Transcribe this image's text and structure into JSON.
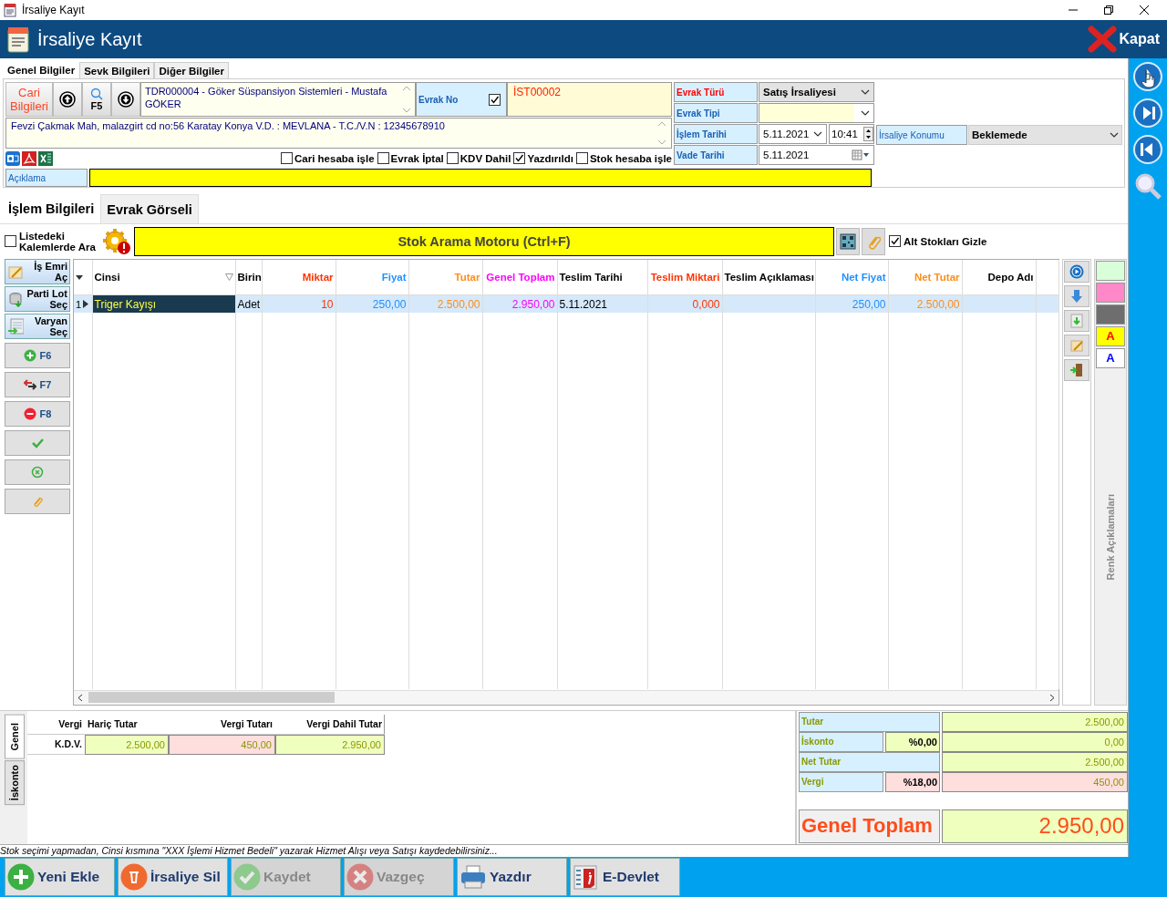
{
  "window": {
    "title": "İrsaliye Kayıt"
  },
  "header": {
    "title": "İrsaliye Kayıt",
    "close_label": "Kapat"
  },
  "top_tabs": [
    {
      "label": "Genel Bilgiler",
      "selected": true
    },
    {
      "label": "Sevk Bilgileri",
      "selected": false
    },
    {
      "label": "Diğer Bilgiler",
      "selected": false
    }
  ],
  "customer": {
    "button": "Cari Bilgileri",
    "search_key": "F5",
    "name": "TDR000004 - Göker Süspansiyon Sistemleri - Mustafa GÖKER",
    "address": "Fevzi Çakmak Mah, malazgirt cd no:56 Karatay Konya V.D. :  MEVLANA - T.C./V.N :  12345678910"
  },
  "evrak_no": {
    "label": "Evrak No",
    "checked": true,
    "value": "İST00002"
  },
  "options": [
    {
      "label": "Cari hesaba işle",
      "checked": false
    },
    {
      "label": "Evrak İptal",
      "checked": false
    },
    {
      "label": "KDV Dahil",
      "checked": false
    },
    {
      "label": "Yazdırıldı",
      "checked": true
    },
    {
      "label": "Stok hesaba işle",
      "checked": false
    }
  ],
  "form": [
    {
      "label": "Evrak Türü",
      "kind": "select",
      "color": "#ff0000",
      "value": "Satış İrsaliyesi"
    },
    {
      "label": "Evrak Tipi",
      "kind": "select",
      "color": "#1a5fb4"
    },
    {
      "label": "İşlem Tarihi",
      "kind": "datetime",
      "color": "#1a5fb4",
      "value": "5.11.2021",
      "time": "10:41"
    },
    {
      "label": "Vade Tarihi",
      "kind": "date",
      "color": "#1a5fb4",
      "value": "5.11.2021"
    }
  ],
  "konum": {
    "label": "İrsaliye Konumu",
    "value": "Beklemede"
  },
  "aciklama": {
    "label": "Açıklama"
  },
  "detail_tabs": [
    {
      "label": "İşlem Bilgileri",
      "selected": true
    },
    {
      "label": "Evrak Görseli",
      "selected": false
    }
  ],
  "search": {
    "in_list_label": "Listedeki Kalemlerde Ara",
    "in_list_checked": false,
    "button": "Stok Arama Motoru (Ctrl+F)",
    "hide_sub_label": "Alt Stokları Gizle",
    "hide_sub_checked": true
  },
  "side_buttons": [
    {
      "label": "İş Emri Aç",
      "kind": "work-order"
    },
    {
      "label": "Parti Lot Seç",
      "kind": "lot"
    },
    {
      "label": "Varyan Seç",
      "kind": "variant"
    },
    {
      "label": "F6",
      "kind": "add"
    },
    {
      "label": "F7",
      "kind": "move"
    },
    {
      "label": "F8",
      "kind": "remove"
    },
    {
      "kind": "confirm"
    },
    {
      "kind": "cancel"
    },
    {
      "kind": "attach"
    }
  ],
  "table": {
    "columns": [
      {
        "label": "Cinsi",
        "color": "#000000"
      },
      {
        "label": "Birin",
        "color": "#000000"
      },
      {
        "label": "Miktar",
        "color": "#ff3300"
      },
      {
        "label": "Fiyat",
        "color": "#1e90ff"
      },
      {
        "label": "Tutar",
        "color": "#ff8c1a"
      },
      {
        "label": "Genel Toplam",
        "color": "#ff00ff"
      },
      {
        "label": "Teslim Tarihi",
        "color": "#000000"
      },
      {
        "label": "Teslim Miktari",
        "color": "#ff3300"
      },
      {
        "label": "Teslim Açıklaması",
        "color": "#000000"
      },
      {
        "label": "Net Fiyat",
        "color": "#1e90ff"
      },
      {
        "label": "Net Tutar",
        "color": "#ff8c1a"
      },
      {
        "label": "Depo Adı",
        "color": "#000000"
      }
    ],
    "rows": [
      {
        "number": "1",
        "selected": true,
        "cells": [
          {
            "text": "Triger Kayışı",
            "focused": true
          },
          {
            "text": "Adet",
            "focused": false
          },
          {
            "text": "10",
            "focused": false
          },
          {
            "text": "250,00",
            "focused": false
          },
          {
            "text": "2.500,00",
            "focused": false
          },
          {
            "text": "2.950,00",
            "focused": false
          },
          {
            "text": "5.11.2021",
            "focused": false
          },
          {
            "text": "0,000",
            "focused": false
          },
          {
            "focused": false
          },
          {
            "text": "250,00",
            "focused": false
          },
          {
            "text": "2.500,00",
            "focused": false
          },
          {
            "focused": false
          }
        ]
      }
    ]
  },
  "color_legend": {
    "title": "Renk Açıklamaları",
    "items": [
      {
        "color": "#d9ffd9"
      },
      {
        "color": "#ff88c8"
      },
      {
        "color": "#6e6e6e"
      },
      {
        "color": "#ffff00",
        "letter": {
          "text": "A",
          "color": "#ff0000"
        }
      },
      {
        "color": "#ffffff",
        "letter": {
          "text": "A",
          "color": "#0000ff"
        }
      }
    ]
  },
  "bottom_tabs": [
    {
      "label": "Genel",
      "selected": true
    },
    {
      "label": "İskonto",
      "selected": false
    }
  ],
  "tax_table": {
    "columns": [
      "Vergi",
      "Hariç Tutar",
      "Vergi Tutarı",
      "Vergi Dahil Tutar"
    ],
    "rows": [
      {
        "cells": [
          {
            "text": "K.D.V."
          },
          {
            "text": "2.500,00",
            "color": "#efffbd"
          },
          {
            "text": "450,00",
            "color": "#ffdede"
          },
          {
            "text": "2.950,00",
            "color": "#efffbd"
          }
        ]
      }
    ]
  },
  "totals": [
    {
      "label": "Tutar",
      "value": "2.500,00",
      "color": "#efffbd"
    },
    {
      "label": "İskonto",
      "rate": "%0,00",
      "value": "0,00",
      "color": "#efffbd"
    },
    {
      "label": "Net Tutar",
      "value": "2.500,00",
      "color": "#efffbd"
    },
    {
      "label": "Vergi",
      "rate": "%18,00",
      "value": "450,00",
      "color": "#ffdede"
    }
  ],
  "grand_total": {
    "label": "Genel Toplam",
    "value": "2.950,00"
  },
  "hint": "Stok seçimi yapmadan, Cinsi kısmına \"XXX İşlemi Hizmet Bedeli\" yazarak Hizmet Alışı veya Satışı kaydedebilirsiniz...",
  "actions": [
    {
      "label": "Yeni Ekle",
      "kind": "add",
      "disabled": false
    },
    {
      "label": "İrsaliye Sil",
      "kind": "delete",
      "disabled": false
    },
    {
      "label": "Kaydet",
      "kind": "save",
      "disabled": true
    },
    {
      "label": "Vazgeç",
      "kind": "cancel",
      "disabled": true
    },
    {
      "label": "Yazdır",
      "kind": "print",
      "disabled": false
    },
    {
      "label": "E-Devlet",
      "kind": "edevlet",
      "disabled": false
    }
  ]
}
